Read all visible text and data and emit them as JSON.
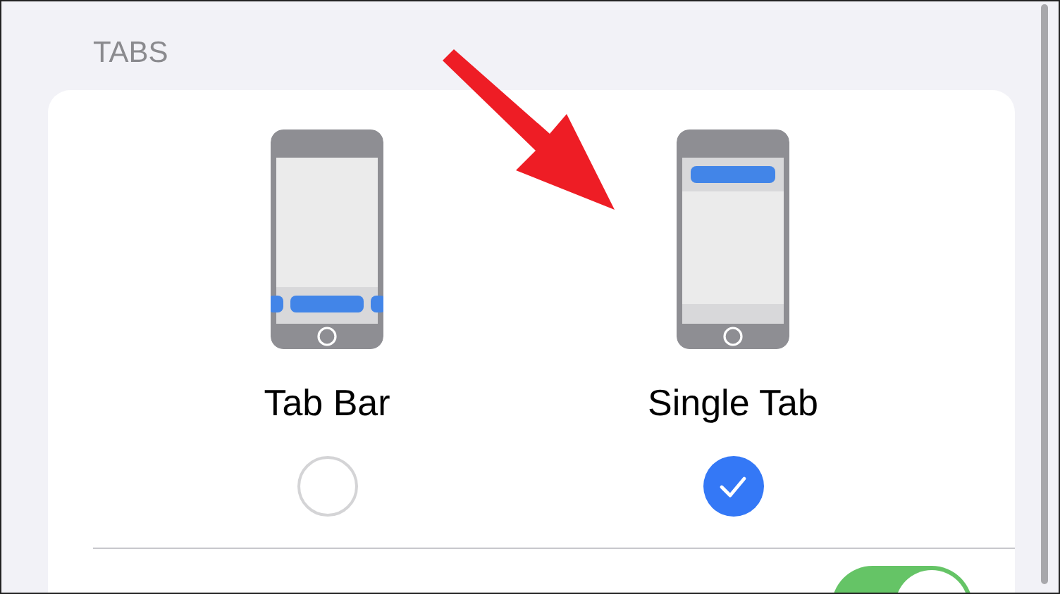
{
  "section_header": "TABS",
  "tab_options": [
    {
      "kind": "tab-bar",
      "label": "Tab Bar",
      "selected": false
    },
    {
      "kind": "single-tab",
      "label": "Single Tab",
      "selected": true
    }
  ],
  "settings": [
    {
      "on": true
    }
  ]
}
